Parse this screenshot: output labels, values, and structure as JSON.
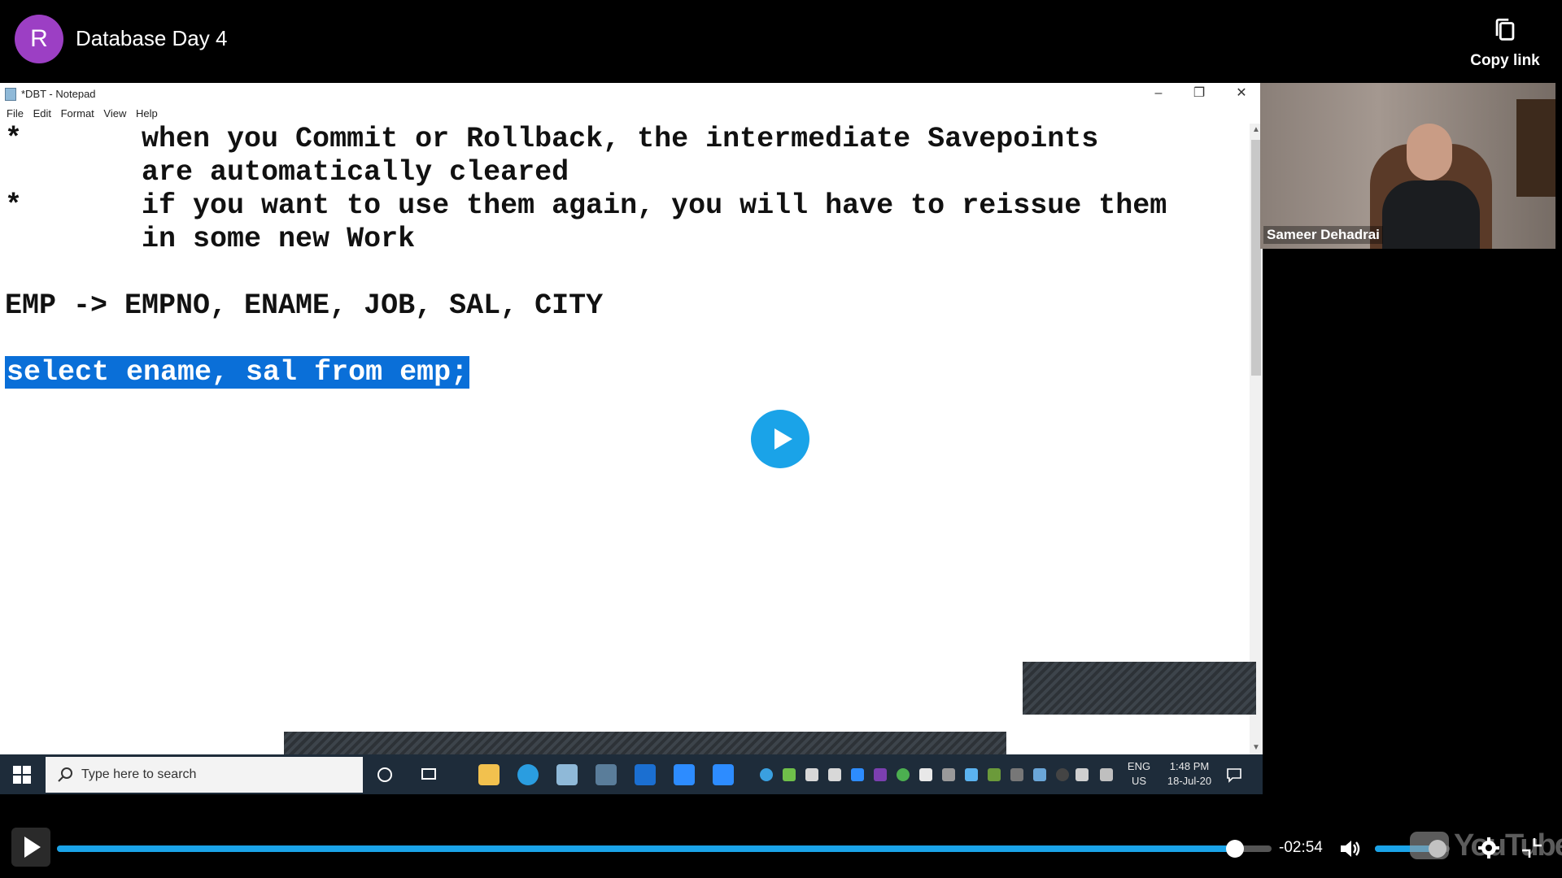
{
  "header": {
    "avatar_letter": "R",
    "avatar_color": "#9c3fc4",
    "title": "Database Day 4",
    "copy_link_label": "Copy link"
  },
  "notepad": {
    "window_title": "*DBT - Notepad",
    "controls": [
      "–",
      "❐",
      "✕"
    ],
    "menu": [
      "File",
      "Edit",
      "Format",
      "View",
      "Help"
    ],
    "lines": [
      {
        "text": "*       when you Commit or Rollback, the intermediate Savepoints"
      },
      {
        "text": "        are automatically cleared"
      },
      {
        "text": "*       if you want to use them again, you will have to reissue them"
      },
      {
        "text": "        in some new Work"
      },
      {
        "text": "EMP -> EMPNO, ENAME, JOB, SAL, CITY"
      },
      {
        "text": "select ename, sal from emp;",
        "selected": true
      }
    ],
    "selection_color": "#0a6fd8"
  },
  "taskbar": {
    "search_placeholder": "Type here to search",
    "lang_top": "ENG",
    "lang_bottom": "US",
    "time": "1:48 PM",
    "date": "18-Jul-20"
  },
  "presenter": {
    "name": "Sameer Dehadrai"
  },
  "player": {
    "time_remaining": "-02:54",
    "progress_fraction": 0.97,
    "volume_fraction": 0.84,
    "logo_text": "YouTube",
    "accent_color": "#1aa3e8"
  }
}
